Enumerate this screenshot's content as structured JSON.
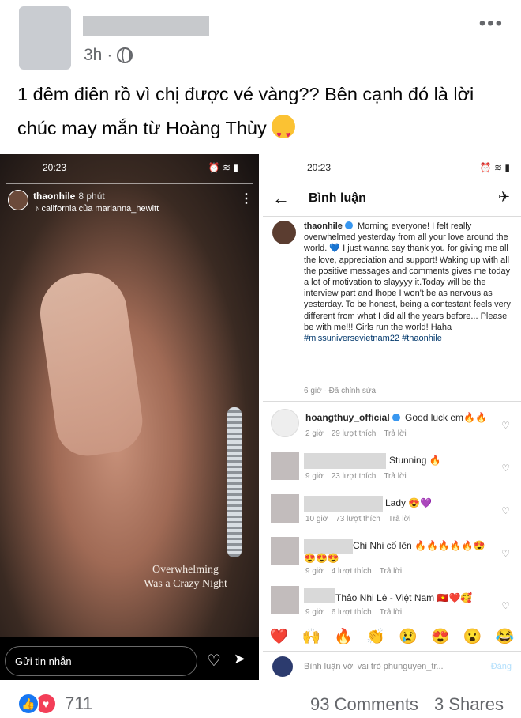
{
  "post": {
    "time": "3h",
    "text": "1 đêm điên rồ vì chị được vé vàng?? Bên cạnh đó là lời chúc may mắn từ Hoàng Thùy"
  },
  "story": {
    "status_time": "20:23",
    "username": "thaonhile",
    "time_ago": "8 phút",
    "music": "♪ california của marianna_hewitt",
    "caption_line1": "Overwhelming",
    "caption_line2": "Was a Crazy Night",
    "message_placeholder": "Gửi tin nhắn"
  },
  "comments_screen": {
    "status_time": "20:23",
    "title": "Bình luận",
    "caption": {
      "username": "thaonhile",
      "first": "Morning everyone!",
      "body": "I felt really overwhelmed yesterday from all your love around the world. 💙 I just wanna say thank you for giving me all the love, appreciation and support! Waking up with all the positive messages and comments gives me today a lot of motivation to slayyyy it.Today will be the interview part and Ihope I won't be as nervous as yesterday. To be honest, being a contestant feels very different from what I did all the years before... Please be with me!!! Girls run the world! Haha",
      "hashtags": "#missuniversevietnam22 #thaonhile",
      "meta": "6 giờ · Đã chỉnh sửa"
    },
    "comments": [
      {
        "user": "hoangthuy_official",
        "text": "Good luck em🔥🔥",
        "time": "2 giờ",
        "likes": "29 lượt thích",
        "reply": "Trả lời"
      },
      {
        "user": "",
        "text": "Stunning 🔥",
        "time": "9 giờ",
        "likes": "23 lượt thích",
        "reply": "Trả lời"
      },
      {
        "user": "",
        "text": "Lady 😍💜",
        "time": "10 giờ",
        "likes": "73 lượt thích",
        "reply": "Trả lời"
      },
      {
        "user": "",
        "text": "Chị Nhi cố lên 🔥🔥🔥🔥🔥😍",
        "text2": "😍😍😍",
        "time": "9 giờ",
        "likes": "4 lượt thích",
        "reply": "Trả lời"
      },
      {
        "user": "",
        "text": "Thảo Nhi Lê - Việt Nam 🇻🇳❤️🥰",
        "time": "9 giờ",
        "likes": "6 lượt thích",
        "reply": "Trả lời"
      }
    ],
    "reaction_bar": [
      "❤️",
      "🙌",
      "🔥",
      "👏",
      "😢",
      "😍",
      "😮",
      "😂"
    ],
    "input_placeholder": "Bình luận với vai trò phunguyen_tr...",
    "post_label": "Đăng"
  },
  "footer": {
    "reaction_count": "711",
    "comments": "93 Comments",
    "shares": "3 Shares"
  },
  "colors": {
    "facebook_blue": "#1877f2",
    "love_red": "#f33e58",
    "instagram_link": "#00376b"
  }
}
